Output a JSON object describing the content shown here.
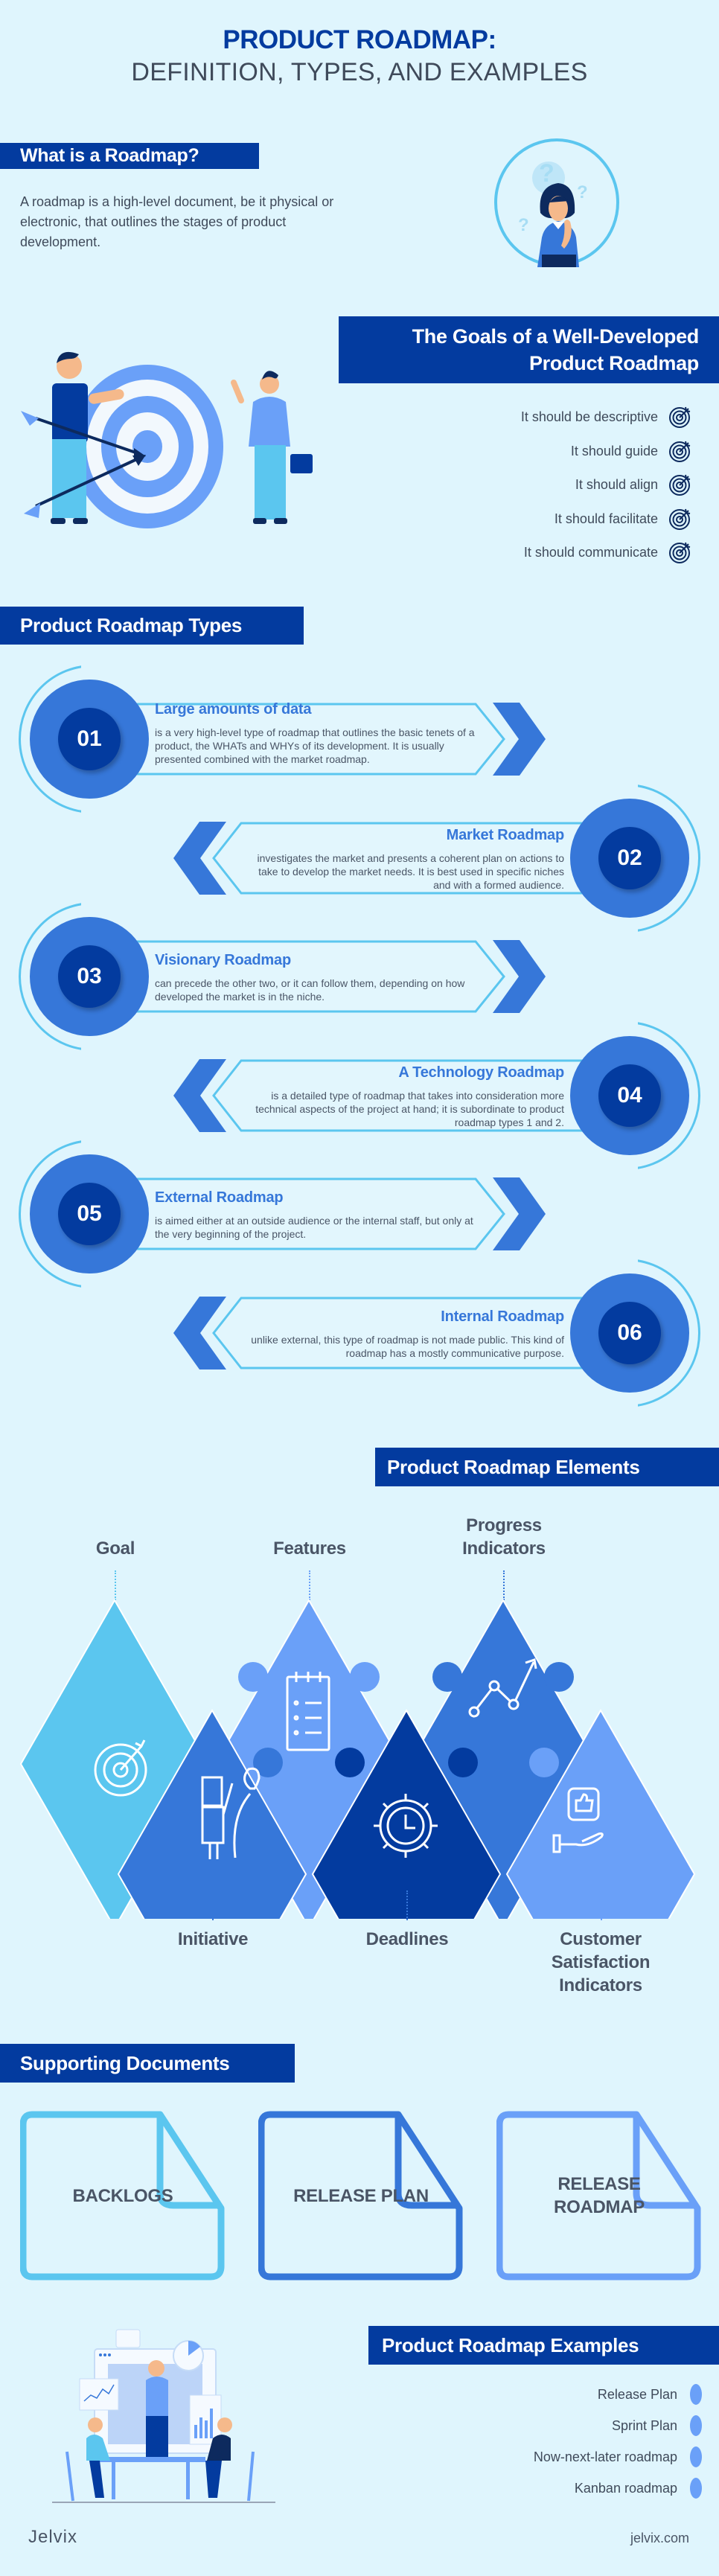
{
  "header": {
    "title_line1": "PRODUCT ROADMAP:",
    "title_line2": "DEFINITION, TYPES, AND EXAMPLES"
  },
  "colors": {
    "background": "#dff5fd",
    "navy": "#033b9f",
    "blue": "#3677d9",
    "light_blue": "#6aa0f8",
    "sky": "#5bc6ef",
    "text": "#4a5566"
  },
  "intro": {
    "heading": "What is a Roadmap?",
    "text": "A roadmap is a high-level document, be it physical or electronic, that outlines the stages of product development.",
    "illustration": "thinking-woman-illustration"
  },
  "goals": {
    "heading_line1": "The Goals of a Well-Developed",
    "heading_line2": "Product Roadmap",
    "illustration": "target-team-illustration",
    "items": [
      {
        "label": "It should be descriptive",
        "icon": "target-icon"
      },
      {
        "label": "It should guide",
        "icon": "target-icon"
      },
      {
        "label": "It should align",
        "icon": "target-icon"
      },
      {
        "label": "It should facilitate",
        "icon": "target-icon"
      },
      {
        "label": "It should communicate",
        "icon": "target-icon"
      }
    ]
  },
  "types": {
    "heading": "Product Roadmap Types",
    "items": [
      {
        "number": "01",
        "title": "Large amounts of data",
        "description": "is a very high-level type of roadmap that outlines the basic tenets of a product, the WHATs and WHYs of its development. It is usually presented combined with the market roadmap.",
        "side": "left"
      },
      {
        "number": "02",
        "title": "Market Roadmap",
        "description": "investigates the market and presents a coherent plan on actions to take to develop the market needs. It is best used in specific niches and with a formed audience.",
        "side": "right"
      },
      {
        "number": "03",
        "title": "Visionary Roadmap",
        "description": "can precede the other two, or it can follow them, depending on how developed the market is in the niche.",
        "side": "left"
      },
      {
        "number": "04",
        "title": "A Technology Roadmap",
        "description": "is a detailed type of roadmap that takes into consideration more technical aspects of the project at hand; it is subordinate to product roadmap types 1 and 2.",
        "side": "right"
      },
      {
        "number": "05",
        "title": "External Roadmap",
        "description": "is aimed either at an outside audience or the internal staff, but only at the very beginning of the project.",
        "side": "left"
      },
      {
        "number": "06",
        "title": "Internal Roadmap",
        "description": "unlike external, this type of roadmap is not made public. This kind of roadmap has a mostly communicative purpose.",
        "side": "right"
      }
    ]
  },
  "elements": {
    "heading": "Product Roadmap Elements",
    "top": [
      {
        "label": "Goal",
        "icon": "target-arrow-icon"
      },
      {
        "label": "Features",
        "icon": "checklist-icon"
      },
      {
        "label": "Progress Indicators",
        "icon": "trend-chart-icon"
      }
    ],
    "bottom": [
      {
        "label": "Initiative",
        "icon": "idea-person-icon"
      },
      {
        "label": "Deadlines",
        "icon": "gear-clock-icon"
      },
      {
        "label": "Customer Satisfaction Indicators",
        "icon": "thumbs-up-hand-icon"
      }
    ]
  },
  "supporting": {
    "heading": "Supporting Documents",
    "docs": [
      {
        "label": "BACKLOGS",
        "color": "#5bc6ef"
      },
      {
        "label": "RELEASE PLAN",
        "color": "#3677d9"
      },
      {
        "label": "RELEASE ROADMAP",
        "color": "#6aa0f8"
      }
    ]
  },
  "examples": {
    "heading": "Product Roadmap Examples",
    "illustration": "team-meeting-illustration",
    "items": [
      {
        "label": "Release Plan"
      },
      {
        "label": "Sprint Plan"
      },
      {
        "label": "Now-next-later roadmap"
      },
      {
        "label": "Kanban roadmap"
      }
    ]
  },
  "footer": {
    "brand": "Jelvix",
    "url": "jelvix.com"
  }
}
